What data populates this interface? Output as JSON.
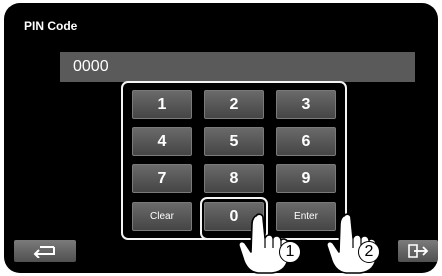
{
  "title": "PIN Code",
  "pin_value": "0000",
  "keypad": {
    "rows": [
      [
        "1",
        "2",
        "3"
      ],
      [
        "4",
        "5",
        "6"
      ],
      [
        "7",
        "8",
        "9"
      ]
    ],
    "clear_label": "Clear",
    "zero_label": "0",
    "enter_label": "Enter"
  },
  "callouts": {
    "first": "1",
    "second": "2"
  },
  "icons": {
    "back": "back-arrow-icon",
    "exit": "exit-door-icon"
  },
  "colors": {
    "background": "#000000",
    "key": "#555555",
    "display": "#5a5a5a",
    "highlight": "#f4f4f4"
  }
}
